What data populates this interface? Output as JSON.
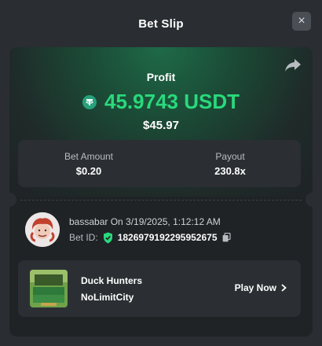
{
  "header": {
    "title": "Bet Slip",
    "close_label": "×"
  },
  "profit": {
    "label": "Profit",
    "amount": "45.9743 USDT",
    "usd_value": "$45.97",
    "currency_icon": "tether-icon",
    "color": "#29d97c"
  },
  "stats": {
    "bet_amount_label": "Bet Amount",
    "bet_amount_value": "$0.20",
    "payout_label": "Payout",
    "payout_value": "230.8x"
  },
  "user": {
    "line": "bassabar On 3/19/2025, 1:12:12 AM",
    "bet_id_label": "Bet ID:",
    "bet_id_value": "1826979192295952675"
  },
  "game": {
    "name": "Duck Hunters",
    "provider": "NoLimitCity",
    "play_label": "Play Now"
  },
  "colors": {
    "accent": "#29d97c",
    "background": "#2a2e32",
    "card": "#1f2326",
    "panel": "#2b2f33"
  }
}
